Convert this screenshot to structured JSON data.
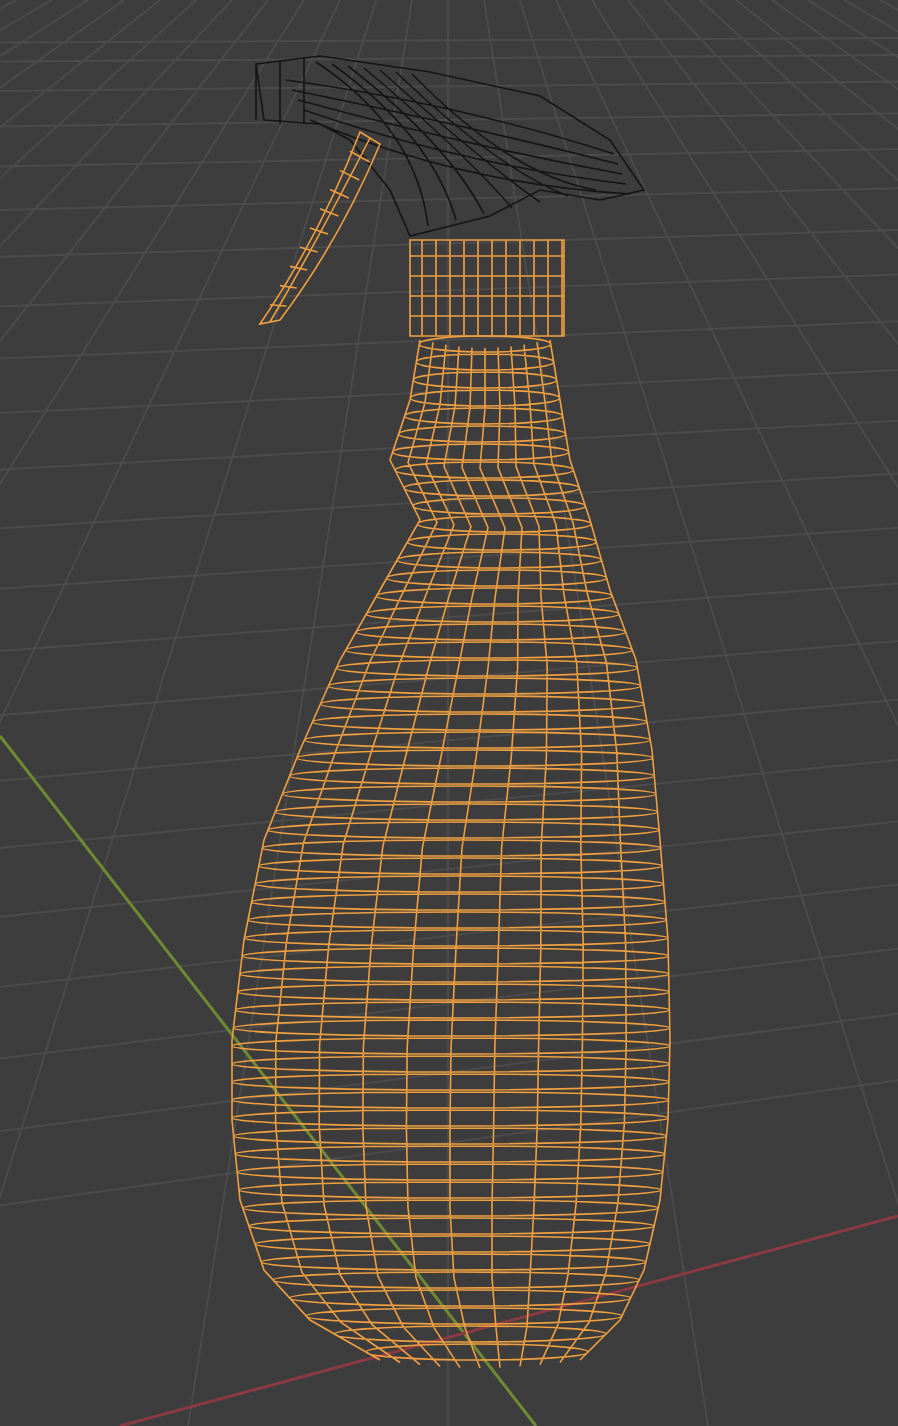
{
  "viewport": {
    "objects": [
      {
        "kind": "spray-head",
        "selected": false
      },
      {
        "kind": "trigger",
        "selected": true
      },
      {
        "kind": "cap",
        "selected": true
      },
      {
        "kind": "body",
        "selected": true
      }
    ]
  }
}
